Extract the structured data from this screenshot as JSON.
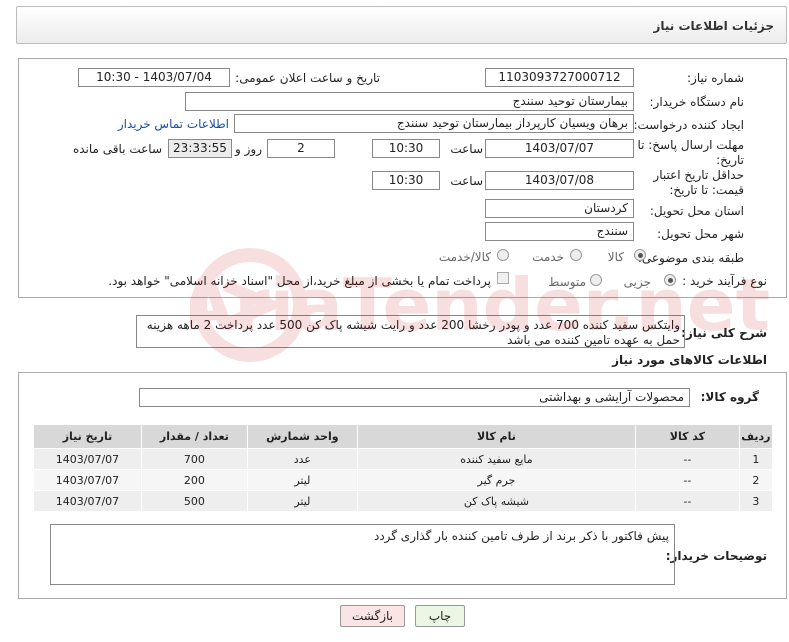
{
  "header": {
    "title": "جزئیات اطلاعات نیاز"
  },
  "form": {
    "need_number_label": "شماره نیاز:",
    "need_number": "1103093727000712",
    "announce_label": "تاریخ و ساعت اعلان عمومی:",
    "announce_value": "1403/07/04 - 10:30",
    "buyer_org_label": "نام دستگاه خریدار:",
    "buyer_org": "بیمارستان توحید سنندج",
    "creator_label": "ایجاد کننده درخواست:",
    "creator": "برهان ویسیان کارپرداز بیمارستان توحید سنندج",
    "contact_link": "اطلاعات تماس خریدار",
    "deadline_label": "مهلت ارسال پاسخ: تا تاریخ:",
    "deadline_date": "1403/07/07",
    "time_label": "ساعت",
    "deadline_time": "10:30",
    "days": "2",
    "days_label": "روز و",
    "remaining": "23:33:55",
    "remaining_label": "ساعت باقی مانده",
    "validity_label": "حداقل تاریخ اعتبار قیمت: تا تاریخ:",
    "validity_date": "1403/07/08",
    "validity_time": "10:30",
    "province_label": "استان محل تحویل:",
    "province": "کردستان",
    "city_label": "شهر محل تحویل:",
    "city": "سنندج",
    "category_label": "طبقه بندی موضوعی:",
    "cat_goods": "کالا",
    "cat_service": "خدمت",
    "cat_both": "کالا/خدمت",
    "process_label": "نوع فرآیند خرید :",
    "proc_partial": "جزیی",
    "proc_medium": "متوسط",
    "payment_note": "پرداخت تمام یا بخشی از مبلغ خرید،از محل \"اسناد خزانه اسلامی\" خواهد بود."
  },
  "description": {
    "label": "شرح کلی نیاز:",
    "text": "وایتکس  سفید کننده 700 عدد و پودر رخشا 200 عدد و رایت  شیشه پاک کن 500 عدد  پرداخت 2 ماهه هزینه حمل به عهده تامین کننده می باشد"
  },
  "goods": {
    "section_title": "اطلاعات کالاهای مورد نیاز",
    "group_label": "گروه کالا:",
    "group_value": "محصولات آرایشی و بهداشتی",
    "columns": [
      "ردیف",
      "کد کالا",
      "نام کالا",
      "واحد شمارش",
      "تعداد / مقدار",
      "تاریخ نیاز"
    ],
    "rows": [
      [
        "1",
        "--",
        "مایع سفید کننده",
        "عدد",
        "700",
        "1403/07/07"
      ],
      [
        "2",
        "--",
        "جرم گیر",
        "لیتر",
        "200",
        "1403/07/07"
      ],
      [
        "3",
        "--",
        "شیشه پاک کن",
        "لیتر",
        "500",
        "1403/07/07"
      ]
    ]
  },
  "buyer_notes": {
    "label": "توضیحات خریدار:",
    "text": "پیش فاکتور با  ذکر برند  از طرف  تامین کننده بار گذاری گردد"
  },
  "buttons": {
    "print": "چاپ",
    "back": "بازگشت"
  },
  "watermark": {
    "text": "AriaTender.net"
  }
}
